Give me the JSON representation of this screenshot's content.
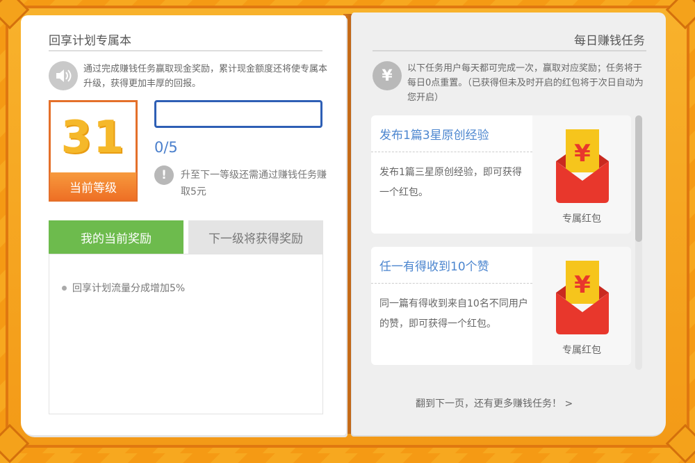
{
  "left_page": {
    "title": "回享计划专属本",
    "notice": "通过完成赚钱任务赢取现金奖励，累计现金额度还将使专属本升级，获得更加丰厚的回报。",
    "level": {
      "number": "31",
      "label": "当前等级"
    },
    "progress": {
      "text": "0/5",
      "fraction": 0
    },
    "hint": "升至下一等级还需通过赚钱任务赚取5元",
    "tabs": {
      "current": "我的当前奖励",
      "next": "下一级将获得奖励"
    },
    "rewards": [
      "回享计划流量分成增加5%"
    ]
  },
  "right_page": {
    "title": "每日赚钱任务",
    "intro": "以下任务用户每天都可完成一次，赢取对应奖励；任务将于每日0点重置。（已获得但未及时开启的红包将于次日自动为您开启）",
    "tasks": [
      {
        "title": "发布1篇3星原创经验",
        "desc": "发布1篇三星原创经验，即可获得一个红包。",
        "reward": "专属红包"
      },
      {
        "title": "任一有得收到10个赞",
        "desc": "同一篇有得收到来自10名不同用户的赞，即可获得一个红包。",
        "reward": "专属红包"
      }
    ],
    "next_page": "翻到下一页，还有更多赚钱任务！ >"
  },
  "colors": {
    "accent_orange": "#ee6f25",
    "tab_green": "#6dbb4d",
    "link_blue": "#4c86cf",
    "packet_red": "#e8372c",
    "packet_gold": "#f6c51c"
  }
}
